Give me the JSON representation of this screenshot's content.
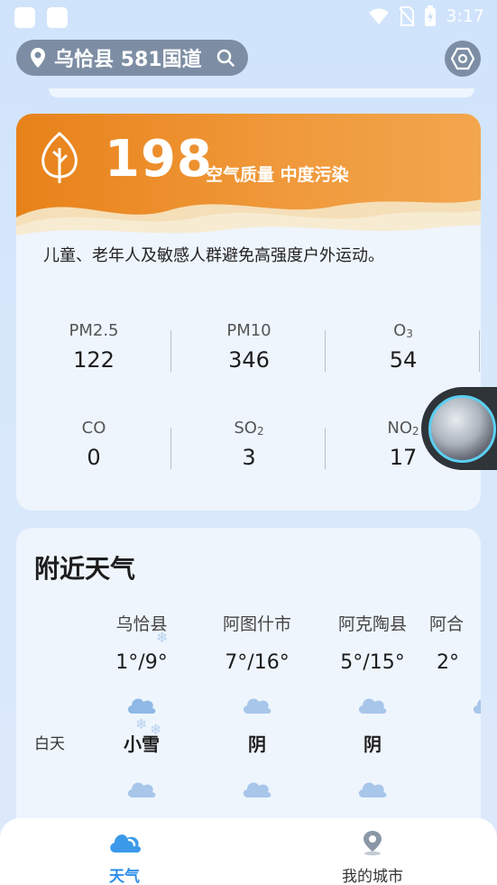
{
  "status_bar": {
    "time": "3:17"
  },
  "header": {
    "location": "乌恰县 581国道"
  },
  "aqi": {
    "value": "198",
    "label": "空气质量 中度污染",
    "advice": "儿童、老年人及敏感人群避免高强度户外运动。",
    "pollutants": [
      {
        "name": "PM2.5",
        "value": "122"
      },
      {
        "name": "PM10",
        "value": "346"
      },
      {
        "name": "O",
        "sub": "3",
        "value": "54"
      },
      {
        "name": "CO",
        "value": "0"
      },
      {
        "name": "SO",
        "sub": "2",
        "value": "3"
      },
      {
        "name": "NO",
        "sub": "2",
        "value": "17"
      }
    ]
  },
  "nearby": {
    "title": "附近天气",
    "row_label_day": "白天",
    "cities": [
      {
        "name": "乌恰县",
        "temp": "1°/9°",
        "condition": "小雪"
      },
      {
        "name": "阿图什市",
        "temp": "7°/16°",
        "condition": "阴"
      },
      {
        "name": "阿克陶县",
        "temp": "5°/15°",
        "condition": "阴"
      },
      {
        "name": "阿合",
        "temp": "2°",
        "condition": ""
      }
    ]
  },
  "nav": {
    "weather": "天气",
    "my_cities": "我的城市",
    "active_color": "#2f8ee8"
  }
}
